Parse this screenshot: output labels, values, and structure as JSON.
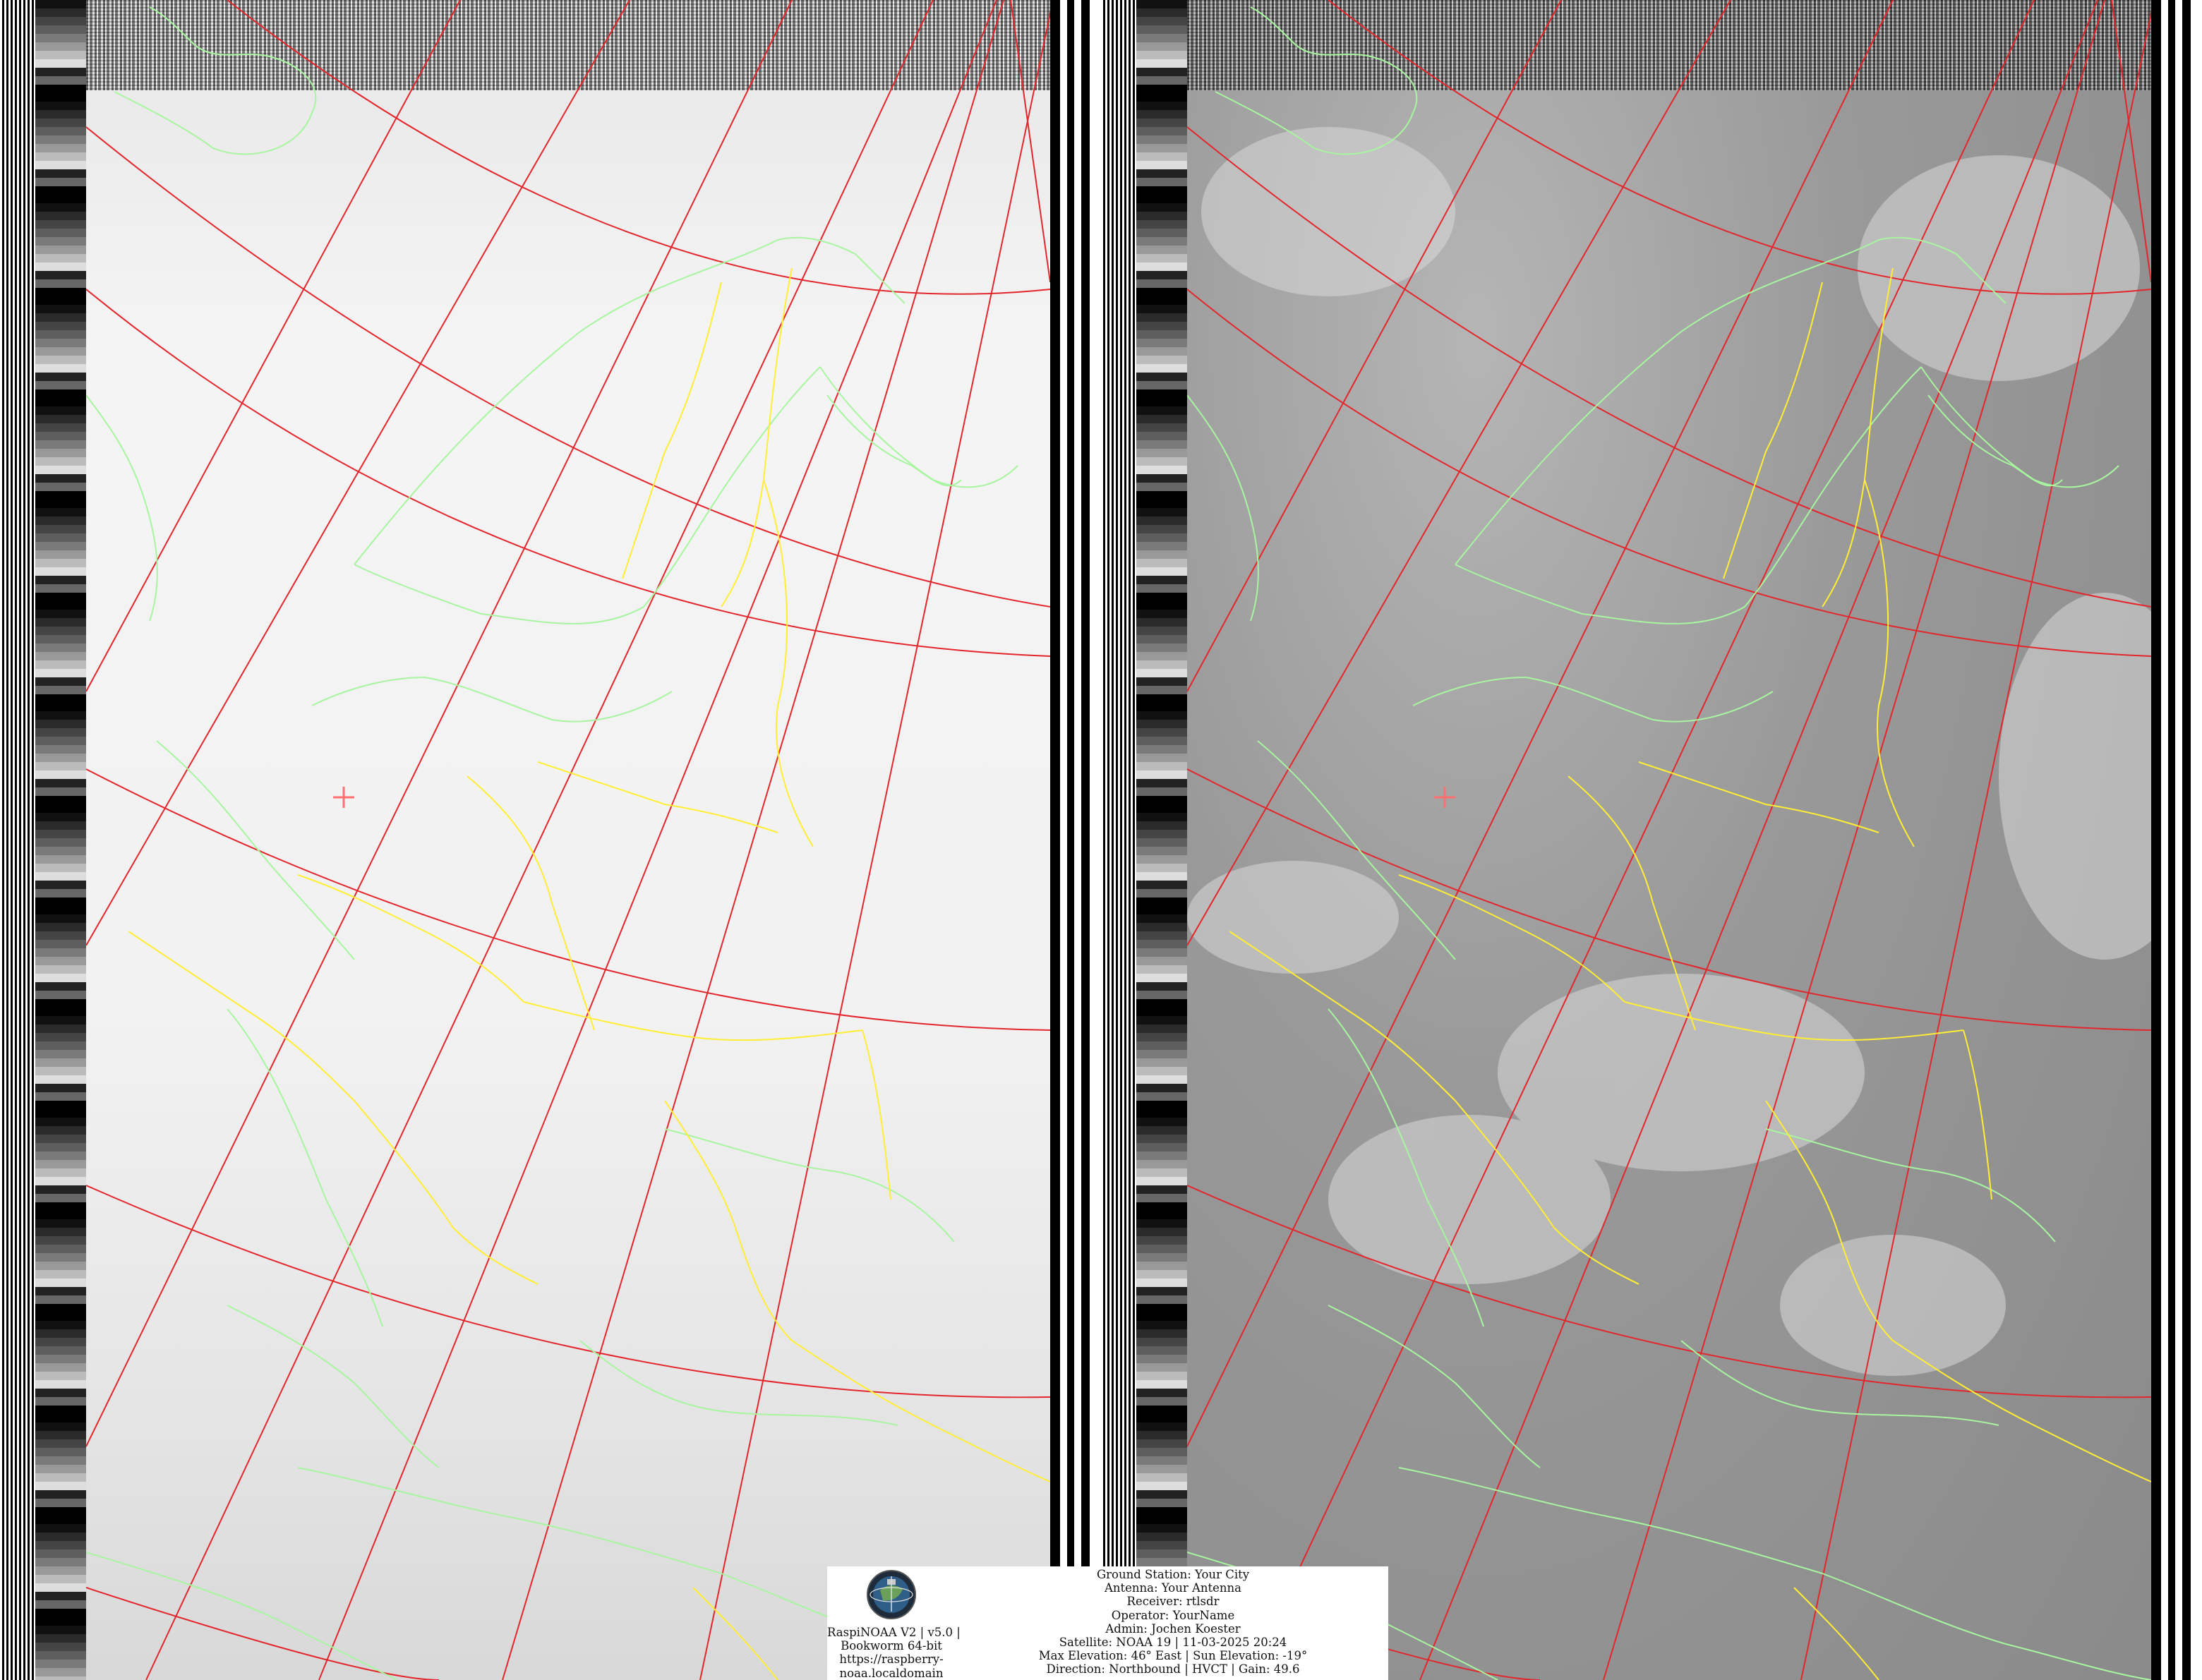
{
  "station_info": {
    "ground_station": "Ground Station: Your City",
    "antenna": "Antenna: Your Antenna",
    "receiver": "Receiver: rtlsdr",
    "operator": "Operator: YourName",
    "admin": "Admin: Jochen Koester",
    "satellite": "Satellite: NOAA 19 | 11-03-2025 20:24",
    "elevation": "Max Elevation: 46° East | Sun Elevation: -19°",
    "direction": "Direction: Northbound | HVCT | Gain: 49.6"
  },
  "software_info": {
    "line1": "RaspiNOAA V2 | v5.0 |",
    "line2": "Bookworm 64-bit",
    "line3": "https://raspberry-",
    "line4": "noaa.localdomain"
  },
  "logo": {
    "icon": "satellite-globe-icon"
  },
  "colors": {
    "graticule": "#e3262c",
    "coastline": "#a8f5a0",
    "borders": "#ffee33",
    "marker": "#ff6f6f",
    "channel_a_bg": "#eeeeee",
    "channel_b_bg": "#9a9a9a"
  }
}
